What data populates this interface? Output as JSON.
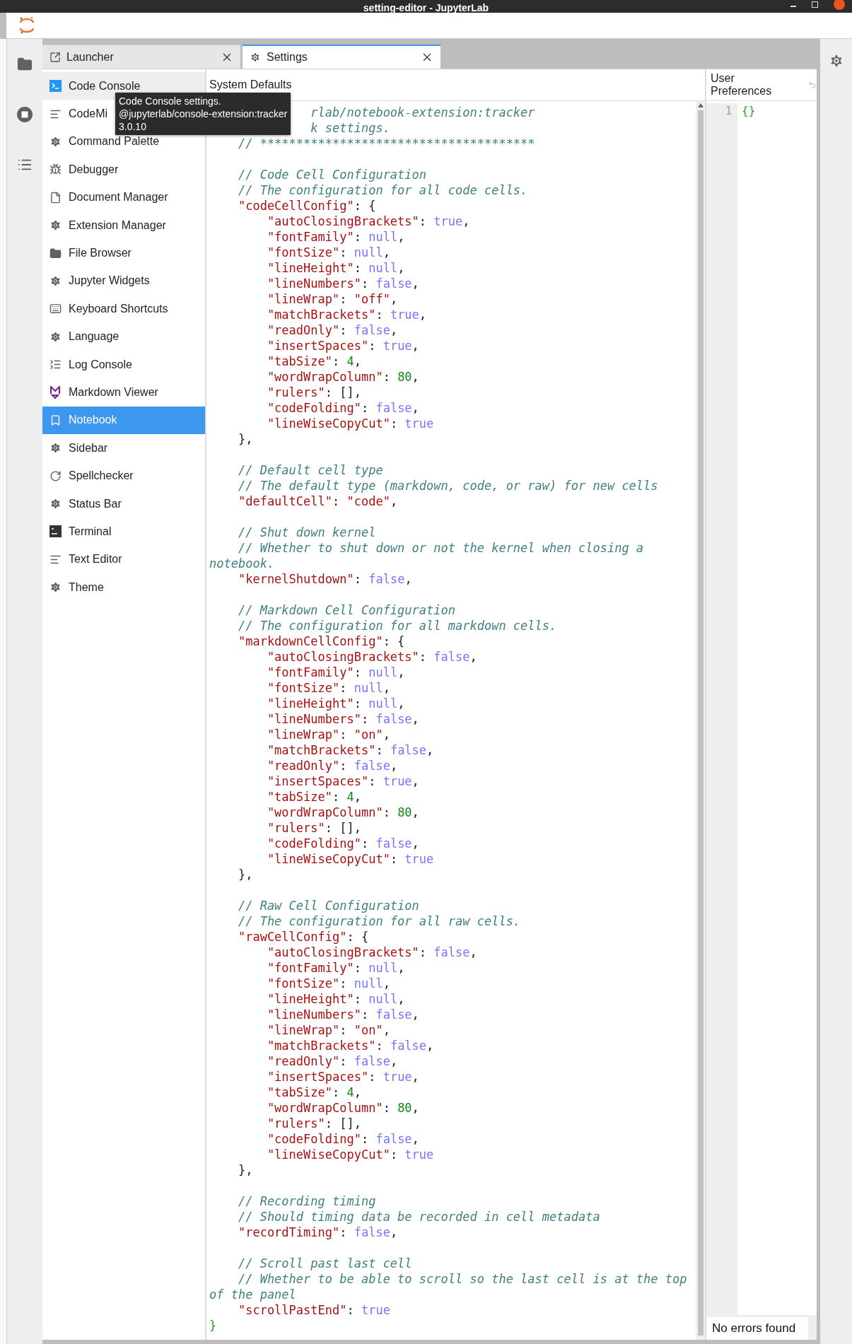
{
  "window": {
    "title": "setting-editor - JupyterLab"
  },
  "tabs": [
    {
      "label": "Launcher",
      "kind": "launcher",
      "selected": false
    },
    {
      "label": "Settings",
      "kind": "settings",
      "selected": true
    }
  ],
  "sidebar": {
    "items": [
      {
        "label": "Code Console",
        "kind": "console",
        "selected": false,
        "hovered": true
      },
      {
        "label": "CodeMi",
        "kind": "lines",
        "selected": false,
        "hovered": false
      },
      {
        "label": "Command Palette",
        "kind": "gear",
        "selected": false,
        "hovered": false
      },
      {
        "label": "Debugger",
        "kind": "bug",
        "selected": false,
        "hovered": false
      },
      {
        "label": "Document Manager",
        "kind": "file",
        "selected": false,
        "hovered": false
      },
      {
        "label": "Extension Manager",
        "kind": "gear",
        "selected": false,
        "hovered": false
      },
      {
        "label": "File Browser",
        "kind": "folder",
        "selected": false,
        "hovered": false
      },
      {
        "label": "Jupyter Widgets",
        "kind": "gear",
        "selected": false,
        "hovered": false
      },
      {
        "label": "Keyboard Shortcuts",
        "kind": "keyboard",
        "selected": false,
        "hovered": false
      },
      {
        "label": "Language",
        "kind": "gear",
        "selected": false,
        "hovered": false
      },
      {
        "label": "Log Console",
        "kind": "list",
        "selected": false,
        "hovered": false
      },
      {
        "label": "Markdown Viewer",
        "kind": "markdown",
        "selected": false,
        "hovered": false
      },
      {
        "label": "Notebook",
        "kind": "notebook",
        "selected": true,
        "hovered": false
      },
      {
        "label": "Sidebar",
        "kind": "gear",
        "selected": false,
        "hovered": false
      },
      {
        "label": "Spellchecker",
        "kind": "refresh",
        "selected": false,
        "hovered": false
      },
      {
        "label": "Status Bar",
        "kind": "gear",
        "selected": false,
        "hovered": false
      },
      {
        "label": "Terminal",
        "kind": "terminal",
        "selected": false,
        "hovered": false
      },
      {
        "label": "Text Editor",
        "kind": "lines",
        "selected": false,
        "hovered": false
      },
      {
        "label": "Theme",
        "kind": "gear",
        "selected": false,
        "hovered": false
      }
    ]
  },
  "tooltip": {
    "lines": [
      "Code Console settings.",
      "@jupyterlab/console-extension:tracker",
      "3.0.10"
    ]
  },
  "system_defaults": {
    "title": "System Defaults",
    "code_lines": [
      {
        "kind": "code",
        "parts": [
          {
            "kind": "comment",
            "text": "              rlab/notebook-extension:tracker"
          }
        ]
      },
      {
        "kind": "code",
        "parts": [
          {
            "kind": "comment",
            "text": "              k settings."
          }
        ]
      },
      {
        "kind": "code",
        "parts": [
          {
            "kind": "comment",
            "text": "    // **************************************"
          }
        ]
      },
      {
        "kind": "blank"
      },
      {
        "kind": "code",
        "parts": [
          {
            "kind": "comment",
            "text": "    // Code Cell Configuration"
          }
        ]
      },
      {
        "kind": "code",
        "parts": [
          {
            "kind": "comment",
            "text": "    // The configuration for all code cells."
          }
        ]
      },
      {
        "kind": "code",
        "parts": [
          {
            "kind": "key",
            "text": "    \"codeCellConfig\""
          },
          {
            "kind": "punct",
            "text": ": {"
          }
        ]
      },
      {
        "kind": "code",
        "parts": [
          {
            "kind": "key",
            "text": "        \"autoClosingBrackets\""
          },
          {
            "kind": "punct",
            "text": ": "
          },
          {
            "kind": "keyword",
            "text": "true"
          },
          {
            "kind": "punct",
            "text": ","
          }
        ]
      },
      {
        "kind": "code",
        "parts": [
          {
            "kind": "key",
            "text": "        \"fontFamily\""
          },
          {
            "kind": "punct",
            "text": ": "
          },
          {
            "kind": "keyword",
            "text": "null"
          },
          {
            "kind": "punct",
            "text": ","
          }
        ]
      },
      {
        "kind": "code",
        "parts": [
          {
            "kind": "key",
            "text": "        \"fontSize\""
          },
          {
            "kind": "punct",
            "text": ": "
          },
          {
            "kind": "keyword",
            "text": "null"
          },
          {
            "kind": "punct",
            "text": ","
          }
        ]
      },
      {
        "kind": "code",
        "parts": [
          {
            "kind": "key",
            "text": "        \"lineHeight\""
          },
          {
            "kind": "punct",
            "text": ": "
          },
          {
            "kind": "keyword",
            "text": "null"
          },
          {
            "kind": "punct",
            "text": ","
          }
        ]
      },
      {
        "kind": "code",
        "parts": [
          {
            "kind": "key",
            "text": "        \"lineNumbers\""
          },
          {
            "kind": "punct",
            "text": ": "
          },
          {
            "kind": "keyword",
            "text": "false"
          },
          {
            "kind": "punct",
            "text": ","
          }
        ]
      },
      {
        "kind": "code",
        "parts": [
          {
            "kind": "key",
            "text": "        \"lineWrap\""
          },
          {
            "kind": "punct",
            "text": ": "
          },
          {
            "kind": "string",
            "text": "\"off\""
          },
          {
            "kind": "punct",
            "text": ","
          }
        ]
      },
      {
        "kind": "code",
        "parts": [
          {
            "kind": "key",
            "text": "        \"matchBrackets\""
          },
          {
            "kind": "punct",
            "text": ": "
          },
          {
            "kind": "keyword",
            "text": "true"
          },
          {
            "kind": "punct",
            "text": ","
          }
        ]
      },
      {
        "kind": "code",
        "parts": [
          {
            "kind": "key",
            "text": "        \"readOnly\""
          },
          {
            "kind": "punct",
            "text": ": "
          },
          {
            "kind": "keyword",
            "text": "false"
          },
          {
            "kind": "punct",
            "text": ","
          }
        ]
      },
      {
        "kind": "code",
        "parts": [
          {
            "kind": "key",
            "text": "        \"insertSpaces\""
          },
          {
            "kind": "punct",
            "text": ": "
          },
          {
            "kind": "keyword",
            "text": "true"
          },
          {
            "kind": "punct",
            "text": ","
          }
        ]
      },
      {
        "kind": "code",
        "parts": [
          {
            "kind": "key",
            "text": "        \"tabSize\""
          },
          {
            "kind": "punct",
            "text": ": "
          },
          {
            "kind": "number",
            "text": "4"
          },
          {
            "kind": "punct",
            "text": ","
          }
        ]
      },
      {
        "kind": "code",
        "parts": [
          {
            "kind": "key",
            "text": "        \"wordWrapColumn\""
          },
          {
            "kind": "punct",
            "text": ": "
          },
          {
            "kind": "number",
            "text": "80"
          },
          {
            "kind": "punct",
            "text": ","
          }
        ]
      },
      {
        "kind": "code",
        "parts": [
          {
            "kind": "key",
            "text": "        \"rulers\""
          },
          {
            "kind": "punct",
            "text": ": [],"
          }
        ]
      },
      {
        "kind": "code",
        "parts": [
          {
            "kind": "key",
            "text": "        \"codeFolding\""
          },
          {
            "kind": "punct",
            "text": ": "
          },
          {
            "kind": "keyword",
            "text": "false"
          },
          {
            "kind": "punct",
            "text": ","
          }
        ]
      },
      {
        "kind": "code",
        "parts": [
          {
            "kind": "key",
            "text": "        \"lineWiseCopyCut\""
          },
          {
            "kind": "punct",
            "text": ": "
          },
          {
            "kind": "keyword",
            "text": "true"
          }
        ]
      },
      {
        "kind": "code",
        "parts": [
          {
            "kind": "punct",
            "text": "    },"
          }
        ]
      },
      {
        "kind": "blank"
      },
      {
        "kind": "code",
        "parts": [
          {
            "kind": "comment",
            "text": "    // Default cell type"
          }
        ]
      },
      {
        "kind": "code",
        "parts": [
          {
            "kind": "comment",
            "text": "    // The default type (markdown, code, or raw) for new cells"
          }
        ]
      },
      {
        "kind": "code",
        "parts": [
          {
            "kind": "key",
            "text": "    \"defaultCell\""
          },
          {
            "kind": "punct",
            "text": ": "
          },
          {
            "kind": "string",
            "text": "\"code\""
          },
          {
            "kind": "punct",
            "text": ","
          }
        ]
      },
      {
        "kind": "blank"
      },
      {
        "kind": "code",
        "parts": [
          {
            "kind": "comment",
            "text": "    // Shut down kernel"
          }
        ]
      },
      {
        "kind": "code",
        "parts": [
          {
            "kind": "comment",
            "text": "    // Whether to shut down or not the kernel when closing a"
          }
        ]
      },
      {
        "kind": "code",
        "parts": [
          {
            "kind": "comment",
            "text": "notebook."
          }
        ]
      },
      {
        "kind": "code",
        "parts": [
          {
            "kind": "key",
            "text": "    \"kernelShutdown\""
          },
          {
            "kind": "punct",
            "text": ": "
          },
          {
            "kind": "keyword",
            "text": "false"
          },
          {
            "kind": "punct",
            "text": ","
          }
        ]
      },
      {
        "kind": "blank"
      },
      {
        "kind": "code",
        "parts": [
          {
            "kind": "comment",
            "text": "    // Markdown Cell Configuration"
          }
        ]
      },
      {
        "kind": "code",
        "parts": [
          {
            "kind": "comment",
            "text": "    // The configuration for all markdown cells."
          }
        ]
      },
      {
        "kind": "code",
        "parts": [
          {
            "kind": "key",
            "text": "    \"markdownCellConfig\""
          },
          {
            "kind": "punct",
            "text": ": {"
          }
        ]
      },
      {
        "kind": "code",
        "parts": [
          {
            "kind": "key",
            "text": "        \"autoClosingBrackets\""
          },
          {
            "kind": "punct",
            "text": ": "
          },
          {
            "kind": "keyword",
            "text": "false"
          },
          {
            "kind": "punct",
            "text": ","
          }
        ]
      },
      {
        "kind": "code",
        "parts": [
          {
            "kind": "key",
            "text": "        \"fontFamily\""
          },
          {
            "kind": "punct",
            "text": ": "
          },
          {
            "kind": "keyword",
            "text": "null"
          },
          {
            "kind": "punct",
            "text": ","
          }
        ]
      },
      {
        "kind": "code",
        "parts": [
          {
            "kind": "key",
            "text": "        \"fontSize\""
          },
          {
            "kind": "punct",
            "text": ": "
          },
          {
            "kind": "keyword",
            "text": "null"
          },
          {
            "kind": "punct",
            "text": ","
          }
        ]
      },
      {
        "kind": "code",
        "parts": [
          {
            "kind": "key",
            "text": "        \"lineHeight\""
          },
          {
            "kind": "punct",
            "text": ": "
          },
          {
            "kind": "keyword",
            "text": "null"
          },
          {
            "kind": "punct",
            "text": ","
          }
        ]
      },
      {
        "kind": "code",
        "parts": [
          {
            "kind": "key",
            "text": "        \"lineNumbers\""
          },
          {
            "kind": "punct",
            "text": ": "
          },
          {
            "kind": "keyword",
            "text": "false"
          },
          {
            "kind": "punct",
            "text": ","
          }
        ]
      },
      {
        "kind": "code",
        "parts": [
          {
            "kind": "key",
            "text": "        \"lineWrap\""
          },
          {
            "kind": "punct",
            "text": ": "
          },
          {
            "kind": "string",
            "text": "\"on\""
          },
          {
            "kind": "punct",
            "text": ","
          }
        ]
      },
      {
        "kind": "code",
        "parts": [
          {
            "kind": "key",
            "text": "        \"matchBrackets\""
          },
          {
            "kind": "punct",
            "text": ": "
          },
          {
            "kind": "keyword",
            "text": "false"
          },
          {
            "kind": "punct",
            "text": ","
          }
        ]
      },
      {
        "kind": "code",
        "parts": [
          {
            "kind": "key",
            "text": "        \"readOnly\""
          },
          {
            "kind": "punct",
            "text": ": "
          },
          {
            "kind": "keyword",
            "text": "false"
          },
          {
            "kind": "punct",
            "text": ","
          }
        ]
      },
      {
        "kind": "code",
        "parts": [
          {
            "kind": "key",
            "text": "        \"insertSpaces\""
          },
          {
            "kind": "punct",
            "text": ": "
          },
          {
            "kind": "keyword",
            "text": "true"
          },
          {
            "kind": "punct",
            "text": ","
          }
        ]
      },
      {
        "kind": "code",
        "parts": [
          {
            "kind": "key",
            "text": "        \"tabSize\""
          },
          {
            "kind": "punct",
            "text": ": "
          },
          {
            "kind": "number",
            "text": "4"
          },
          {
            "kind": "punct",
            "text": ","
          }
        ]
      },
      {
        "kind": "code",
        "parts": [
          {
            "kind": "key",
            "text": "        \"wordWrapColumn\""
          },
          {
            "kind": "punct",
            "text": ": "
          },
          {
            "kind": "number",
            "text": "80"
          },
          {
            "kind": "punct",
            "text": ","
          }
        ]
      },
      {
        "kind": "code",
        "parts": [
          {
            "kind": "key",
            "text": "        \"rulers\""
          },
          {
            "kind": "punct",
            "text": ": [],"
          }
        ]
      },
      {
        "kind": "code",
        "parts": [
          {
            "kind": "key",
            "text": "        \"codeFolding\""
          },
          {
            "kind": "punct",
            "text": ": "
          },
          {
            "kind": "keyword",
            "text": "false"
          },
          {
            "kind": "punct",
            "text": ","
          }
        ]
      },
      {
        "kind": "code",
        "parts": [
          {
            "kind": "key",
            "text": "        \"lineWiseCopyCut\""
          },
          {
            "kind": "punct",
            "text": ": "
          },
          {
            "kind": "keyword",
            "text": "true"
          }
        ]
      },
      {
        "kind": "code",
        "parts": [
          {
            "kind": "punct",
            "text": "    },"
          }
        ]
      },
      {
        "kind": "blank"
      },
      {
        "kind": "code",
        "parts": [
          {
            "kind": "comment",
            "text": "    // Raw Cell Configuration"
          }
        ]
      },
      {
        "kind": "code",
        "parts": [
          {
            "kind": "comment",
            "text": "    // The configuration for all raw cells."
          }
        ]
      },
      {
        "kind": "code",
        "parts": [
          {
            "kind": "key",
            "text": "    \"rawCellConfig\""
          },
          {
            "kind": "punct",
            "text": ": {"
          }
        ]
      },
      {
        "kind": "code",
        "parts": [
          {
            "kind": "key",
            "text": "        \"autoClosingBrackets\""
          },
          {
            "kind": "punct",
            "text": ": "
          },
          {
            "kind": "keyword",
            "text": "false"
          },
          {
            "kind": "punct",
            "text": ","
          }
        ]
      },
      {
        "kind": "code",
        "parts": [
          {
            "kind": "key",
            "text": "        \"fontFamily\""
          },
          {
            "kind": "punct",
            "text": ": "
          },
          {
            "kind": "keyword",
            "text": "null"
          },
          {
            "kind": "punct",
            "text": ","
          }
        ]
      },
      {
        "kind": "code",
        "parts": [
          {
            "kind": "key",
            "text": "        \"fontSize\""
          },
          {
            "kind": "punct",
            "text": ": "
          },
          {
            "kind": "keyword",
            "text": "null"
          },
          {
            "kind": "punct",
            "text": ","
          }
        ]
      },
      {
        "kind": "code",
        "parts": [
          {
            "kind": "key",
            "text": "        \"lineHeight\""
          },
          {
            "kind": "punct",
            "text": ": "
          },
          {
            "kind": "keyword",
            "text": "null"
          },
          {
            "kind": "punct",
            "text": ","
          }
        ]
      },
      {
        "kind": "code",
        "parts": [
          {
            "kind": "key",
            "text": "        \"lineNumbers\""
          },
          {
            "kind": "punct",
            "text": ": "
          },
          {
            "kind": "keyword",
            "text": "false"
          },
          {
            "kind": "punct",
            "text": ","
          }
        ]
      },
      {
        "kind": "code",
        "parts": [
          {
            "kind": "key",
            "text": "        \"lineWrap\""
          },
          {
            "kind": "punct",
            "text": ": "
          },
          {
            "kind": "string",
            "text": "\"on\""
          },
          {
            "kind": "punct",
            "text": ","
          }
        ]
      },
      {
        "kind": "code",
        "parts": [
          {
            "kind": "key",
            "text": "        \"matchBrackets\""
          },
          {
            "kind": "punct",
            "text": ": "
          },
          {
            "kind": "keyword",
            "text": "false"
          },
          {
            "kind": "punct",
            "text": ","
          }
        ]
      },
      {
        "kind": "code",
        "parts": [
          {
            "kind": "key",
            "text": "        \"readOnly\""
          },
          {
            "kind": "punct",
            "text": ": "
          },
          {
            "kind": "keyword",
            "text": "false"
          },
          {
            "kind": "punct",
            "text": ","
          }
        ]
      },
      {
        "kind": "code",
        "parts": [
          {
            "kind": "key",
            "text": "        \"insertSpaces\""
          },
          {
            "kind": "punct",
            "text": ": "
          },
          {
            "kind": "keyword",
            "text": "true"
          },
          {
            "kind": "punct",
            "text": ","
          }
        ]
      },
      {
        "kind": "code",
        "parts": [
          {
            "kind": "key",
            "text": "        \"tabSize\""
          },
          {
            "kind": "punct",
            "text": ": "
          },
          {
            "kind": "number",
            "text": "4"
          },
          {
            "kind": "punct",
            "text": ","
          }
        ]
      },
      {
        "kind": "code",
        "parts": [
          {
            "kind": "key",
            "text": "        \"wordWrapColumn\""
          },
          {
            "kind": "punct",
            "text": ": "
          },
          {
            "kind": "number",
            "text": "80"
          },
          {
            "kind": "punct",
            "text": ","
          }
        ]
      },
      {
        "kind": "code",
        "parts": [
          {
            "kind": "key",
            "text": "        \"rulers\""
          },
          {
            "kind": "punct",
            "text": ": [],"
          }
        ]
      },
      {
        "kind": "code",
        "parts": [
          {
            "kind": "key",
            "text": "        \"codeFolding\""
          },
          {
            "kind": "punct",
            "text": ": "
          },
          {
            "kind": "keyword",
            "text": "false"
          },
          {
            "kind": "punct",
            "text": ","
          }
        ]
      },
      {
        "kind": "code",
        "parts": [
          {
            "kind": "key",
            "text": "        \"lineWiseCopyCut\""
          },
          {
            "kind": "punct",
            "text": ": "
          },
          {
            "kind": "keyword",
            "text": "true"
          }
        ]
      },
      {
        "kind": "code",
        "parts": [
          {
            "kind": "punct",
            "text": "    },"
          }
        ]
      },
      {
        "kind": "blank"
      },
      {
        "kind": "code",
        "parts": [
          {
            "kind": "comment",
            "text": "    // Recording timing"
          }
        ]
      },
      {
        "kind": "code",
        "parts": [
          {
            "kind": "comment",
            "text": "    // Should timing data be recorded in cell metadata"
          }
        ]
      },
      {
        "kind": "code",
        "parts": [
          {
            "kind": "key",
            "text": "    \"recordTiming\""
          },
          {
            "kind": "punct",
            "text": ": "
          },
          {
            "kind": "keyword",
            "text": "false"
          },
          {
            "kind": "punct",
            "text": ","
          }
        ]
      },
      {
        "kind": "blank"
      },
      {
        "kind": "code",
        "parts": [
          {
            "kind": "comment",
            "text": "    // Scroll past last cell"
          }
        ]
      },
      {
        "kind": "code",
        "parts": [
          {
            "kind": "comment",
            "text": "    // Whether to be able to scroll so the last cell is at the top"
          }
        ]
      },
      {
        "kind": "code",
        "parts": [
          {
            "kind": "comment",
            "text": "of the panel"
          }
        ]
      },
      {
        "kind": "code",
        "parts": [
          {
            "kind": "key",
            "text": "    \"scrollPastEnd\""
          },
          {
            "kind": "punct",
            "text": ": "
          },
          {
            "kind": "keyword",
            "text": "true"
          }
        ]
      },
      {
        "kind": "code",
        "parts": [
          {
            "kind": "bracket",
            "text": "}"
          }
        ]
      }
    ]
  },
  "user_preferences": {
    "title": "User Preferences",
    "line_numbers": [
      "1"
    ],
    "code_lines": [
      {
        "kind": "code",
        "parts": [
          {
            "kind": "bracket",
            "text": "{}"
          }
        ]
      }
    ],
    "status": "No errors found"
  }
}
